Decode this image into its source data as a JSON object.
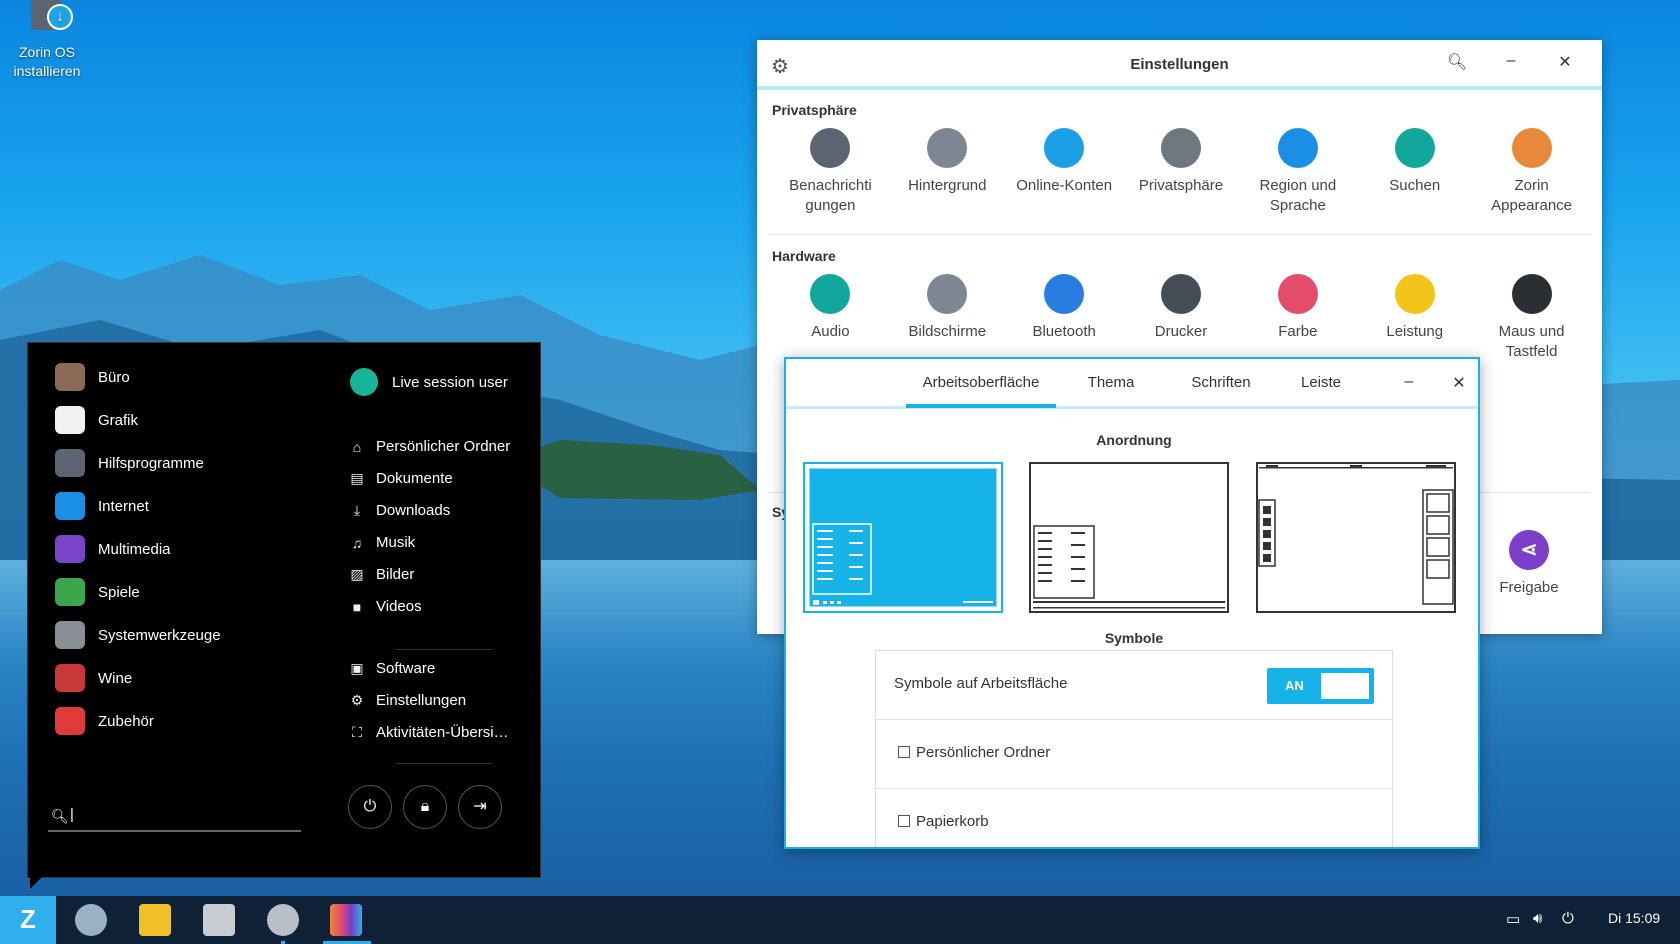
{
  "desktop": {
    "icon_label_1": "Zorin OS",
    "icon_label_2": "installieren"
  },
  "settings": {
    "title": "Einstellungen",
    "privacy_title": "Privatsphäre",
    "privacy_items": [
      {
        "label1": "Benachrichti",
        "label2": "gungen",
        "icon": "notifications-icon",
        "color": "#5b6470"
      },
      {
        "label1": "Hintergrund",
        "label2": "",
        "icon": "background-icon",
        "color": "#7d8792"
      },
      {
        "label1": "Online-Konten",
        "label2": "",
        "icon": "online-accounts-icon",
        "color": "#1a9fe5"
      },
      {
        "label1": "Privatsphäre",
        "label2": "",
        "icon": "privacy-icon",
        "color": "#6f7780"
      },
      {
        "label1": "Region und",
        "label2": "Sprache",
        "icon": "region-language-icon",
        "color": "#1a8fe5"
      },
      {
        "label1": "Suchen",
        "label2": "",
        "icon": "search-icon",
        "color": "#12a79d"
      },
      {
        "label1": "Zorin",
        "label2": "Appearance",
        "icon": "zorin-appearance-icon",
        "color": "#e8893a"
      }
    ],
    "hardware_title": "Hardware",
    "hardware_items": [
      {
        "label1": "Audio",
        "label2": "",
        "icon": "audio-icon",
        "color": "#12a79d"
      },
      {
        "label1": "Bildschirme",
        "label2": "",
        "icon": "displays-icon",
        "color": "#7d8792"
      },
      {
        "label1": "Bluetooth",
        "label2": "",
        "icon": "bluetooth-icon",
        "color": "#2a7de0"
      },
      {
        "label1": "Drucker",
        "label2": "",
        "icon": "printer-icon",
        "color": "#444c55"
      },
      {
        "label1": "Farbe",
        "label2": "",
        "icon": "color-icon",
        "color": "#e34d6a"
      },
      {
        "label1": "Leistung",
        "label2": "",
        "icon": "power-icon",
        "color": "#f2c318"
      },
      {
        "label1": "Maus und",
        "label2": "Tastfeld",
        "icon": "mouse-icon",
        "color": "#2b2f34"
      }
    ],
    "system_partial": "Sy",
    "freigabe": "Freigabe"
  },
  "appearance": {
    "tabs": [
      "Arbeitsoberfläche",
      "Thema",
      "Schriften",
      "Leiste"
    ],
    "anordnung": "Anordnung",
    "symbole": "Symbole",
    "desktop_icons_label": "Symbole auf Arbeitsfläche",
    "toggle_on": "AN",
    "home_folder": "Persönlicher Ordner",
    "trash": "Papierkorb"
  },
  "menu": {
    "categories": [
      {
        "label": "Büro",
        "icon": "office-icon",
        "color": "#8a6a55"
      },
      {
        "label": "Grafik",
        "icon": "graphics-icon",
        "color": "#f2f2f2"
      },
      {
        "label": "Hilfsprogramme",
        "icon": "utilities-icon",
        "color": "#5b6470"
      },
      {
        "label": "Internet",
        "icon": "internet-icon",
        "color": "#1a8fe5"
      },
      {
        "label": "Multimedia",
        "icon": "multimedia-icon",
        "color": "#7a44c8"
      },
      {
        "label": "Spiele",
        "icon": "games-icon",
        "color": "#3aa84a"
      },
      {
        "label": "Systemwerkzeuge",
        "icon": "system-tools-icon",
        "color": "#8a8f95"
      },
      {
        "label": "Wine",
        "icon": "wine-icon",
        "color": "#c8373a"
      },
      {
        "label": "Zubehör",
        "icon": "accessories-icon",
        "color": "#e03a3a"
      }
    ],
    "user": "Live session user",
    "places": [
      {
        "label": "Persönlicher Ordner",
        "glyph": "⌂"
      },
      {
        "label": "Dokumente",
        "glyph": "▤"
      },
      {
        "label": "Downloads",
        "glyph": "⤓"
      },
      {
        "label": "Musik",
        "glyph": "♫"
      },
      {
        "label": "Bilder",
        "glyph": "▨"
      },
      {
        "label": "Videos",
        "glyph": "■"
      }
    ],
    "system": [
      {
        "label": "Software",
        "glyph": "▣"
      },
      {
        "label": "Einstellungen",
        "glyph": "⚙"
      },
      {
        "label": "Aktivitäten-Übersi…",
        "glyph": "⛶"
      }
    ],
    "search_cursor": "|"
  },
  "taskbar": {
    "clock": "Di 15:09"
  }
}
